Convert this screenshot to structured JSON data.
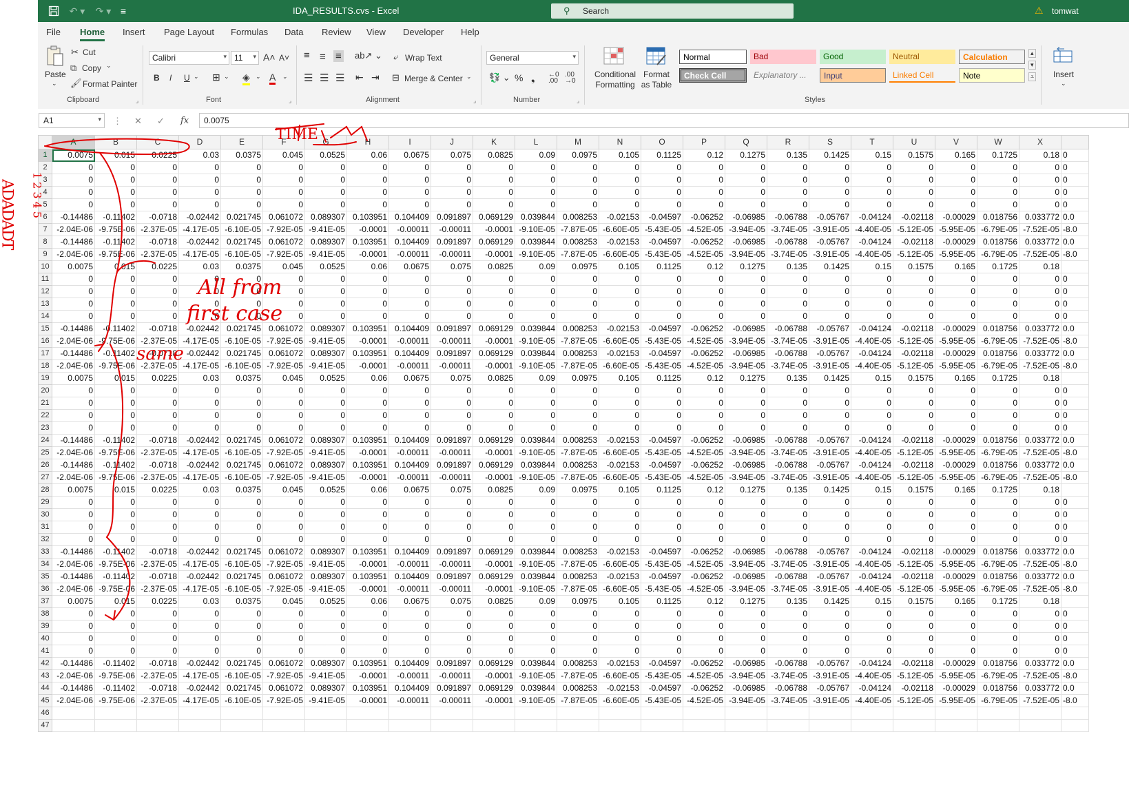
{
  "titlebar": {
    "title": "IDA_RESULTS.cvs  -  Excel",
    "search_placeholder": "Search",
    "user": "tomwat"
  },
  "menu": {
    "tabs": [
      "File",
      "Home",
      "Insert",
      "Page Layout",
      "Formulas",
      "Data",
      "Review",
      "View",
      "Developer",
      "Help"
    ],
    "active": "Home"
  },
  "ribbon": {
    "clipboard": {
      "paste": "Paste",
      "cut": "Cut",
      "copy": "Copy",
      "format_painter": "Format Painter",
      "label": "Clipboard"
    },
    "font": {
      "name": "Calibri",
      "size": "11",
      "label": "Font"
    },
    "alignment": {
      "wrap_text": "Wrap Text",
      "merge_center": "Merge & Center",
      "label": "Alignment"
    },
    "number": {
      "format": "General",
      "label": "Number"
    },
    "styles": {
      "conditional_formatting": "Conditional Formatting",
      "format_as_table": "Format as Table",
      "cells": [
        "Normal",
        "Bad",
        "Good",
        "Neutral",
        "Calculation",
        "Check Cell",
        "Explanatory ...",
        "Input",
        "Linked Cell",
        "Note"
      ],
      "label": "Styles"
    },
    "cells": {
      "insert": "Insert"
    }
  },
  "formula_bar": {
    "name_box": "A1",
    "value": "0.0075"
  },
  "sheet": {
    "columns": [
      "A",
      "B",
      "C",
      "D",
      "E",
      "F",
      "G",
      "H",
      "I",
      "J",
      "K",
      "L",
      "M",
      "N",
      "O",
      "P",
      "Q",
      "R",
      "S",
      "T",
      "U",
      "V",
      "W",
      "X"
    ],
    "overflow_partial": [
      "0",
      "0",
      "0",
      "0",
      "0",
      "0.0",
      "-8.0",
      "0.0",
      "-8.0",
      "",
      "0",
      "0",
      "0",
      "0",
      "0.0",
      "-8.0",
      "0.0",
      "-8.0",
      "",
      "0",
      "0",
      "0",
      "0",
      "0.0",
      "-8.0",
      "0.0",
      "-8.0",
      "",
      "0",
      "0",
      "0",
      "0",
      "0.0",
      "-8.0",
      "0.0",
      "-8.0",
      "",
      "0",
      "0",
      "0",
      "0",
      "0.0",
      "-8.0",
      "0.0",
      "-8.0",
      "",
      ""
    ],
    "row_types": [
      "time",
      "zero",
      "zero",
      "zero",
      "zero",
      "neg",
      "sci",
      "neg",
      "sci",
      "time",
      "zero",
      "zero",
      "zero",
      "zero",
      "neg",
      "sci",
      "neg",
      "sci",
      "time",
      "zero",
      "zero",
      "zero",
      "zero",
      "neg",
      "sci",
      "neg",
      "sci",
      "time",
      "zero",
      "zero",
      "zero",
      "zero",
      "neg",
      "sci",
      "neg",
      "sci",
      "time",
      "zero",
      "zero",
      "zero",
      "zero",
      "neg",
      "sci",
      "neg",
      "sci",
      "empty",
      "empty"
    ],
    "patterns": {
      "time": [
        "0.0075",
        "0.015",
        "0.0225",
        "0.03",
        "0.0375",
        "0.045",
        "0.0525",
        "0.06",
        "0.0675",
        "0.075",
        "0.0825",
        "0.09",
        "0.0975",
        "0.105",
        "0.1125",
        "0.12",
        "0.1275",
        "0.135",
        "0.1425",
        "0.15",
        "0.1575",
        "0.165",
        "0.1725",
        "0.18"
      ],
      "zero": [
        "0",
        "0",
        "0",
        "0",
        "0",
        "0",
        "0",
        "0",
        "0",
        "0",
        "0",
        "0",
        "0",
        "0",
        "0",
        "0",
        "0",
        "0",
        "0",
        "0",
        "0",
        "0",
        "0",
        "0"
      ],
      "neg": [
        "-0.14486",
        "-0.11402",
        "-0.0718",
        "-0.02442",
        "0.021745",
        "0.061072",
        "0.089307",
        "0.103951",
        "0.104409",
        "0.091897",
        "0.069129",
        "0.039844",
        "0.008253",
        "-0.02153",
        "-0.04597",
        "-0.06252",
        "-0.06985",
        "-0.06788",
        "-0.05767",
        "-0.04124",
        "-0.02118",
        "-0.00029",
        "0.018756",
        "0.033772"
      ],
      "sci": [
        "-2.04E-06",
        "-9.75E-06",
        "-2.37E-05",
        "-4.17E-05",
        "-6.10E-05",
        "-7.92E-05",
        "-9.41E-05",
        "-0.0001",
        "-0.00011",
        "-0.00011",
        "-0.0001",
        "-9.10E-05",
        "-7.87E-05",
        "-6.60E-05",
        "-5.43E-05",
        "-4.52E-05",
        "-3.94E-05",
        "-3.74E-05",
        "-3.91E-05",
        "-4.40E-05",
        "-5.12E-05",
        "-5.95E-05",
        "-6.79E-05",
        "-7.52E-05"
      ],
      "empty": [
        "",
        "",
        "",
        "",
        "",
        "",
        "",
        "",
        "",
        "",
        "",
        "",
        "",
        "",
        "",
        "",
        "",
        "",
        "",
        "",
        "",
        "",
        "",
        ""
      ]
    }
  },
  "annotations": {
    "time": "TIME",
    "all_from": "All from",
    "first_case": "first case",
    "same": "same",
    "vertical_left": "ADADADT",
    "vertical_small": "12345"
  }
}
